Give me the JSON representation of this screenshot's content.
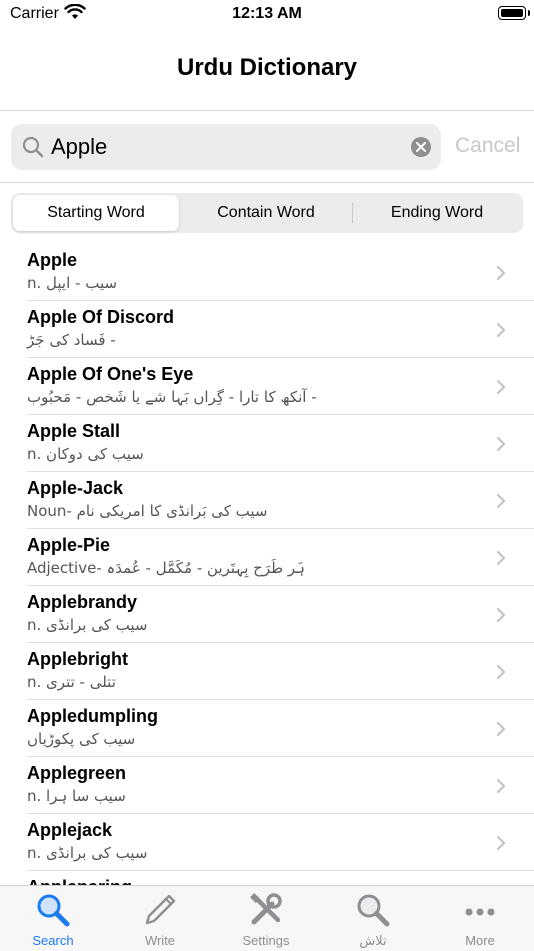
{
  "status": {
    "carrier": "Carrier",
    "time": "12:13 AM"
  },
  "nav": {
    "title": "Urdu Dictionary"
  },
  "search": {
    "value": "Apple",
    "cancel_label": "Cancel"
  },
  "segments": [
    "Starting Word",
    "Contain Word",
    "Ending Word"
  ],
  "segment_selected": "Starting Word",
  "results": [
    {
      "word": "Apple",
      "meaning": "n. سیب - ایپل"
    },
    {
      "word": "Apple Of Discord",
      "meaning": "فَساد کی جَڑ -"
    },
    {
      "word": "Apple Of One's Eye",
      "meaning": "آنکھ کا تارا - گِراں بَہا شے یا شَخص - مَحبُوب -"
    },
    {
      "word": "Apple Stall",
      "meaning": "n. سیب کی دوکان"
    },
    {
      "word": "Apple-Jack",
      "meaning": "Noun- سیب کی بَرانڈی کا امریکی نام"
    },
    {
      "word": "Apple-Pie",
      "meaning": "Adjective- ہَر طَرَح بِہتَرین - مُکَمَّل - عُمدَہ"
    },
    {
      "word": "Applebrandy",
      "meaning": "n. سیب کی برانڈی"
    },
    {
      "word": "Applebright",
      "meaning": "n. تتلی - تتری"
    },
    {
      "word": "Appledumpling",
      "meaning": "سیب کی پکوڑیاں"
    },
    {
      "word": "Applegreen",
      "meaning": "n. سیب سا ہرا"
    },
    {
      "word": "Applejack",
      "meaning": "n. سیب کی برانڈی"
    },
    {
      "word": "Appleparing",
      "meaning": ""
    }
  ],
  "tabs": [
    {
      "label": "Search",
      "icon": "search-icon",
      "active": true
    },
    {
      "label": "Write",
      "icon": "pencil-icon",
      "active": false
    },
    {
      "label": "Settings",
      "icon": "tools-icon",
      "active": false
    },
    {
      "label": "تلاش",
      "icon": "search-icon",
      "active": false
    },
    {
      "label": "More",
      "icon": "more-icon",
      "active": false
    }
  ],
  "colors": {
    "accent": "#1a7bf0",
    "inactive": "#8e8e93",
    "cancel": "#c7c7cc"
  }
}
